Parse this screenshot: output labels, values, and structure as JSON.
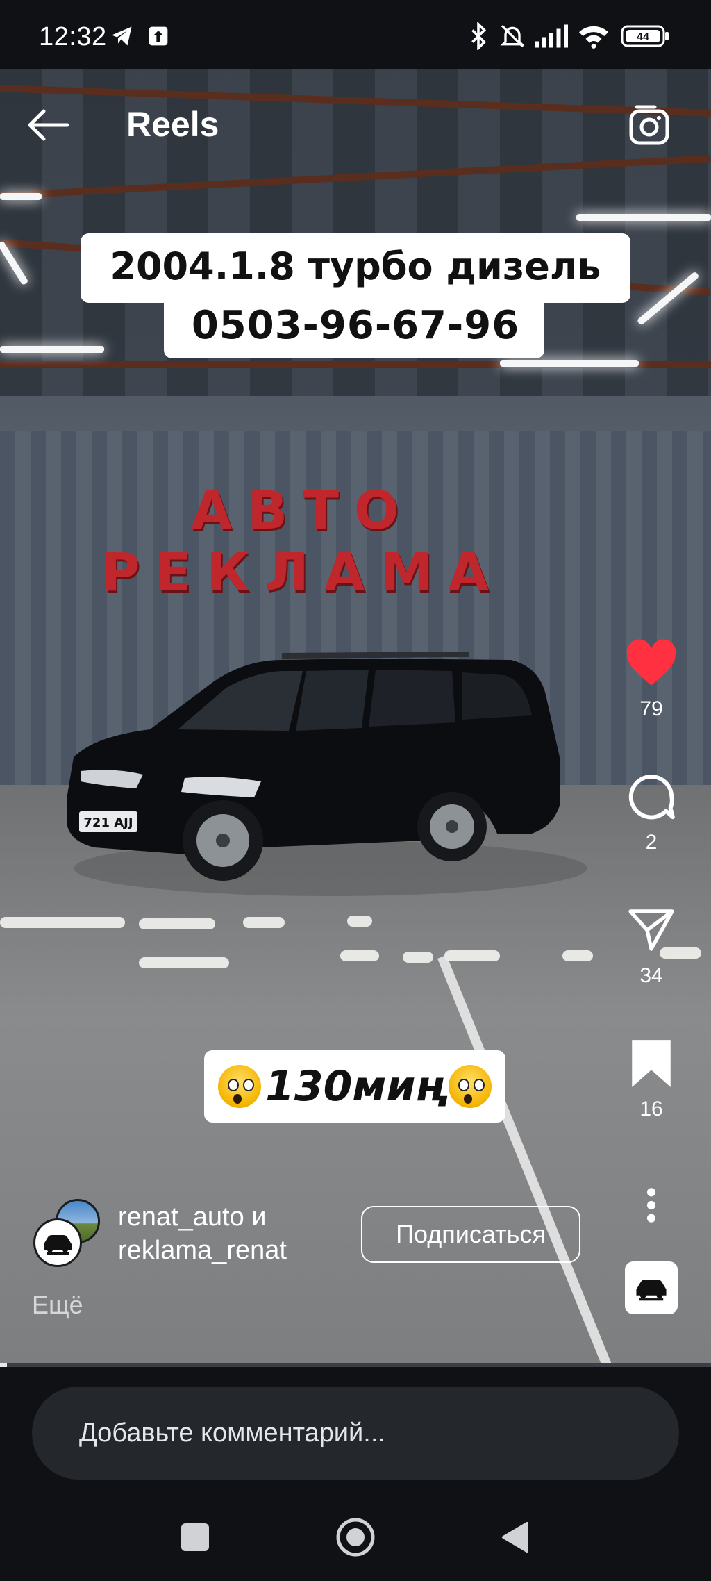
{
  "status_bar": {
    "time": "12:32",
    "icons": [
      "telegram-icon",
      "upload-icon",
      "bluetooth-icon",
      "mute-icon",
      "signal-icon",
      "wifi-icon",
      "battery-icon"
    ],
    "battery": "44"
  },
  "header": {
    "back_icon": "arrow-left-icon",
    "title": "Reels",
    "camera_icon": "camera-icon"
  },
  "video": {
    "caption_top_line1": "2004.1.8 турбо дизель",
    "caption_top_line2": "0503-96-67-96",
    "wall_sign": "АВТО РЕКЛАМА",
    "plate": "721 AJJ",
    "caption_bottom": "130миң",
    "progress": 0.01
  },
  "actions": {
    "likes": "79",
    "comments": "2",
    "shares": "34",
    "saves": "16"
  },
  "author": {
    "line1": "renat_auto и",
    "line2": "reklama_renat",
    "subscribe_label": "Подписаться",
    "more_label": "Ещё"
  },
  "comment": {
    "placeholder": "Добавьте комментарий..."
  },
  "colors": {
    "like": "#ff3040",
    "background": "#0f1114",
    "sign": "#c0272d"
  }
}
